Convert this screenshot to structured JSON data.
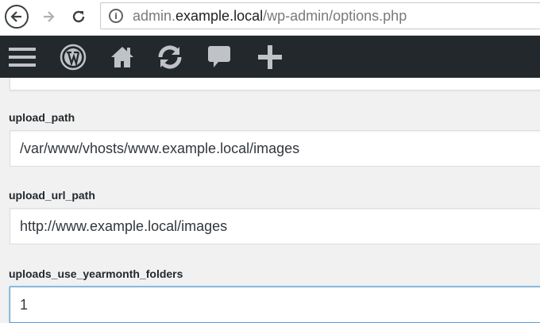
{
  "browser": {
    "url_prefix": "admin.",
    "url_domain": "example.local",
    "url_path": "/wp-admin/options.php"
  },
  "admin_bar": {
    "icons": [
      "menu-icon",
      "wordpress-logo-icon",
      "home-icon",
      "updates-icon",
      "comments-icon",
      "new-content-icon"
    ]
  },
  "options": [
    {
      "name": "upload_path",
      "value": "/var/www/vhosts/www.example.local/images"
    },
    {
      "name": "upload_url_path",
      "value": "http://www.example.local/images"
    },
    {
      "name": "uploads_use_yearmonth_folders",
      "value": "1"
    }
  ],
  "colors": {
    "admin_bar": "#23282d",
    "page_bg": "#f1f1f1",
    "focus_border": "#5b9dd9"
  }
}
